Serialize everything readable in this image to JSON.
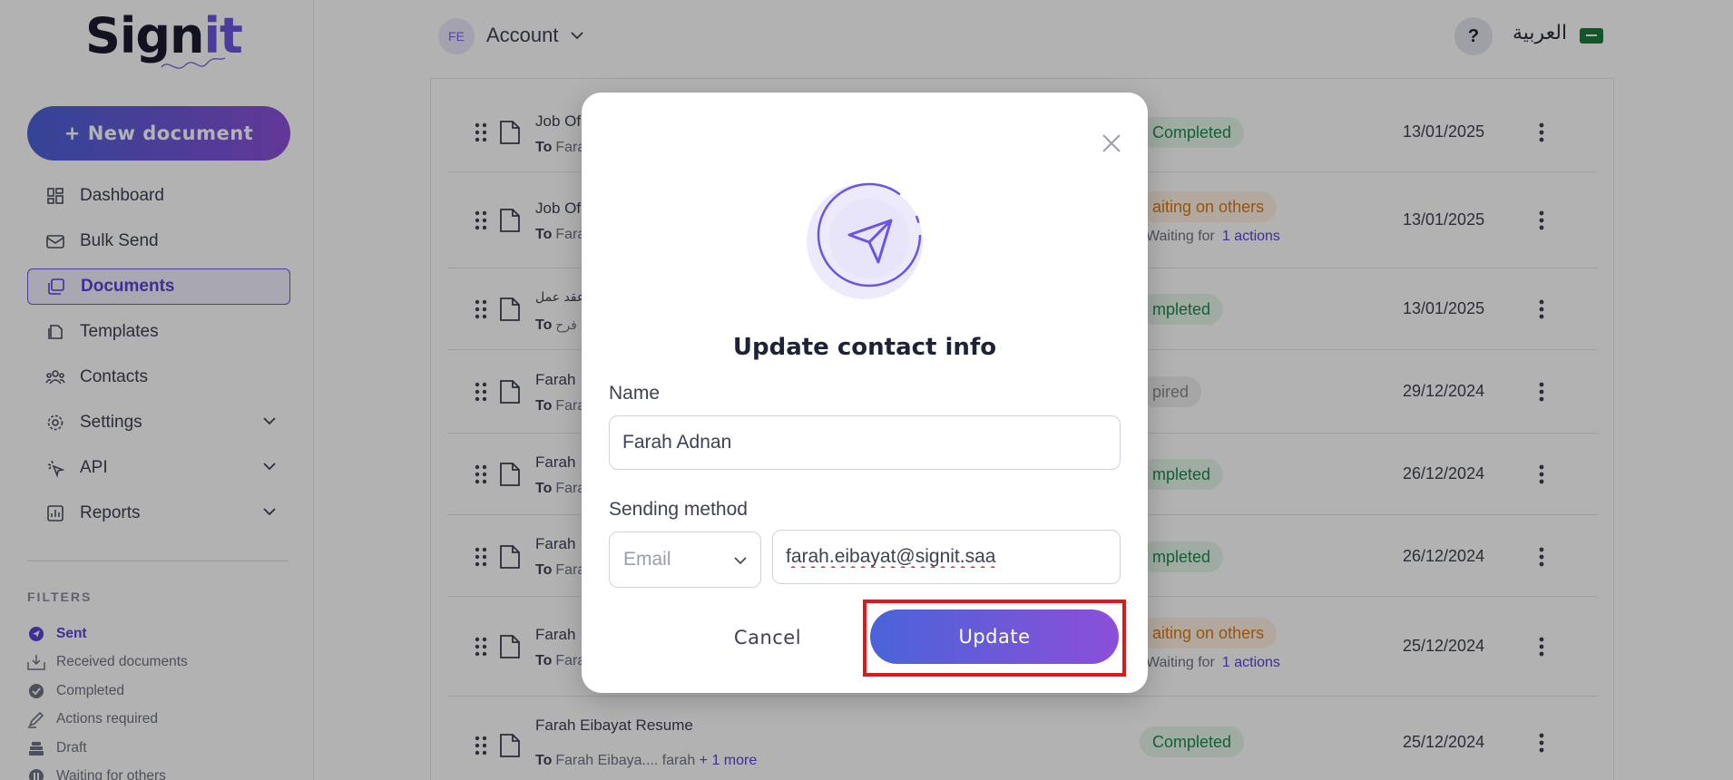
{
  "brand": {
    "logo_main": "Sign",
    "logo_accent": "it",
    "new_document_label": "+ New document"
  },
  "sidebar": {
    "items": [
      {
        "label": "Dashboard",
        "icon": "dashboard-icon"
      },
      {
        "label": "Bulk Send",
        "icon": "mail-icon"
      },
      {
        "label": "Documents",
        "icon": "documents-icon",
        "active": true
      },
      {
        "label": "Templates",
        "icon": "template-icon"
      },
      {
        "label": "Contacts",
        "icon": "contacts-icon"
      },
      {
        "label": "Settings",
        "icon": "gear-icon",
        "expandable": true
      },
      {
        "label": "API",
        "icon": "cursor-click-icon",
        "expandable": true
      },
      {
        "label": "Reports",
        "icon": "chart-icon",
        "expandable": true
      }
    ],
    "filters_title": "FILTERS",
    "filters": [
      {
        "label": "Sent",
        "active": true
      },
      {
        "label": "Received documents"
      },
      {
        "label": "Completed"
      },
      {
        "label": "Actions required"
      },
      {
        "label": "Draft"
      },
      {
        "label": "Waiting for others"
      }
    ]
  },
  "header": {
    "avatar_initials": "FE",
    "account_label": "Account",
    "help_label": "?",
    "language_label": "العربية"
  },
  "documents": [
    {
      "title": "Job Of",
      "to": "Fara",
      "status": "Completed",
      "date": "13/01/2025"
    },
    {
      "title": "Job Of",
      "to": "Fara",
      "status": "aiting on others",
      "waiting_label": "Waiting for",
      "waiting_actions": "1 actions",
      "date": "13/01/2025"
    },
    {
      "title": "عقد عمل",
      "to": "فرح",
      "status": "mpleted",
      "date": "13/01/2025"
    },
    {
      "title": "Farah",
      "to": "Fara",
      "status": "pired",
      "date": "29/12/2024"
    },
    {
      "title": "Farah",
      "to": "Fara",
      "status": "mpleted",
      "date": "26/12/2024"
    },
    {
      "title": "Farah",
      "to": "Fara",
      "status": "mpleted",
      "date": "26/12/2024"
    },
    {
      "title": "Farah",
      "to": "Fara",
      "status": "aiting on others",
      "waiting_label": "Waiting for",
      "waiting_actions": "1 actions",
      "date": "25/12/2024"
    },
    {
      "title": "Farah Eibayat Resume",
      "to": "Farah Eibaya.... farah",
      "more": "+ 1 more",
      "status": "Completed",
      "date": "25/12/2024"
    }
  ],
  "to_prefix": "To",
  "modal": {
    "title": "Update contact info",
    "name_label": "Name",
    "name_value": "Farah Adnan",
    "sending_method_label": "Sending method",
    "method_value": "Email",
    "email_value": "farah.eibayat@signit.saa",
    "cancel_label": "Cancel",
    "update_label": "Update"
  },
  "colors": {
    "accent": "#5a42d6",
    "gradient_start": "#4a63d8",
    "gradient_end": "#8c4fd9",
    "completed": "#1e8a4a",
    "waiting": "#d57a18",
    "highlight": "#e01818"
  }
}
